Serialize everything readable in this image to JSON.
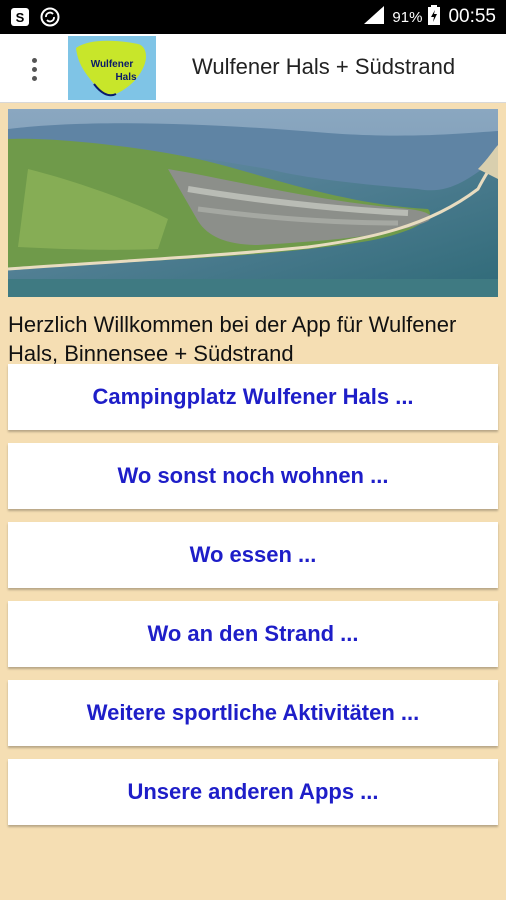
{
  "status_bar": {
    "left_icons": [
      "notification-s-icon",
      "sync-icon"
    ],
    "signal_icon": "signal-icon",
    "battery_percent": "91%",
    "battery_icon": "battery-charging-icon",
    "time": "00:55"
  },
  "app_bar": {
    "menu_icon": "overflow-menu-icon",
    "logo_text_line1": "Wulfener",
    "logo_text_line2": "Hals",
    "title": "Wulfener Hals + Südstrand"
  },
  "welcome_text": "Herzlich Willkommen bei der App für Wulfener Hals, Binnensee + Südstrand",
  "buttons": [
    {
      "label": "Campingplatz Wulfener Hals ..."
    },
    {
      "label": "Wo sonst noch wohnen ..."
    },
    {
      "label": "Wo essen ..."
    },
    {
      "label": "Wo an den Strand ..."
    },
    {
      "label": "Weitere sportliche Aktivitäten ..."
    },
    {
      "label": "Unsere anderen Apps ..."
    }
  ],
  "colors": {
    "background": "#f5deb3",
    "button_text": "#1e1ec8",
    "status_bar": "#000000"
  }
}
